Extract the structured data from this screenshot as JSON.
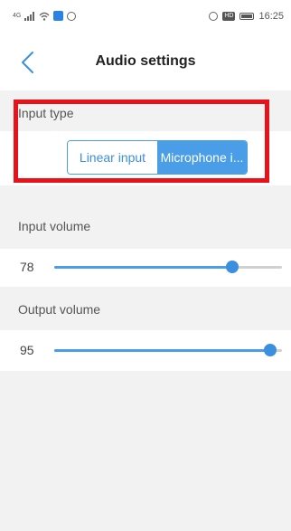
{
  "status_bar": {
    "time": "16:25",
    "network_label": "4G",
    "hd_badge": "HD"
  },
  "header": {
    "title": "Audio settings"
  },
  "input_type": {
    "label": "Input type",
    "options": [
      "Linear input",
      "Microphone i..."
    ],
    "selected": "Microphone i..."
  },
  "input_volume": {
    "label": "Input volume",
    "value": "78",
    "fraction": 0.78
  },
  "output_volume": {
    "label": "Output volume",
    "value": "95",
    "fraction": 0.95
  },
  "colors": {
    "accent": "#4a9ee8",
    "highlight": "#e8121b"
  }
}
